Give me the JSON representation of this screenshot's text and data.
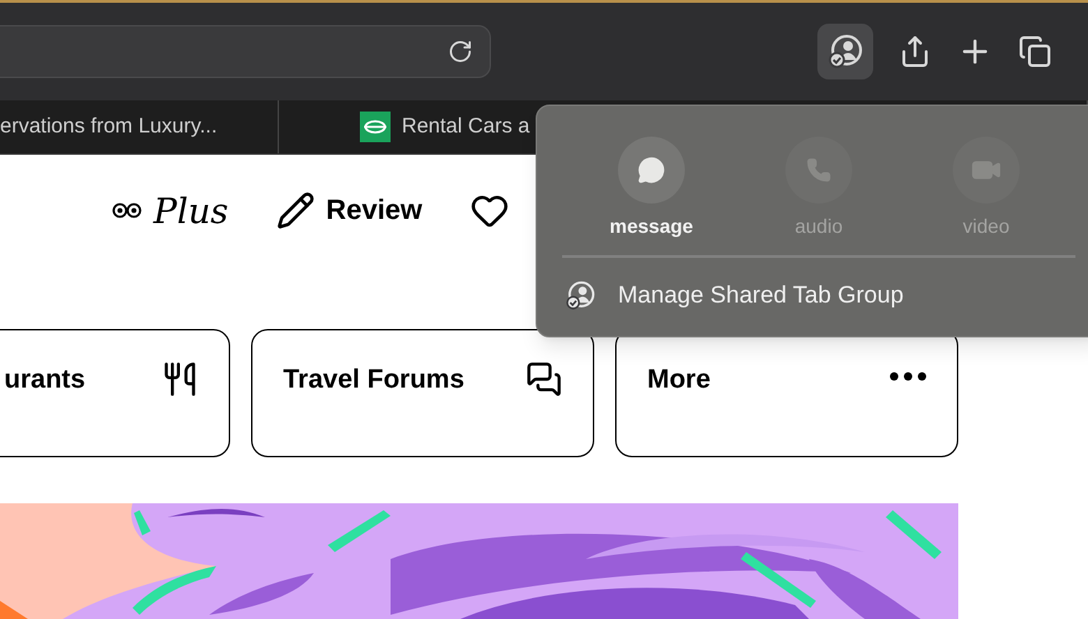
{
  "toolbar": {
    "share_button_selected": true
  },
  "tabs": [
    {
      "title": "ervations from Luxury...",
      "has_icon": false
    },
    {
      "title": "Rental Cars a",
      "has_icon": true
    }
  ],
  "header_nav": [
    {
      "kind": "plus",
      "label": "Plus"
    },
    {
      "kind": "review",
      "label": "Review"
    },
    {
      "kind": "heart"
    }
  ],
  "category_cards": [
    {
      "label": "urants",
      "kind": "restaurants"
    },
    {
      "label": "Travel Forums",
      "kind": "forums"
    },
    {
      "label": "More",
      "kind": "more"
    }
  ],
  "share_popover": {
    "actions": [
      {
        "label": "message",
        "kind": "message",
        "disabled": false
      },
      {
        "label": "audio",
        "kind": "audio",
        "disabled": true
      },
      {
        "label": "video",
        "kind": "video",
        "disabled": true
      }
    ],
    "menu_item": "Manage Shared Tab Group"
  }
}
